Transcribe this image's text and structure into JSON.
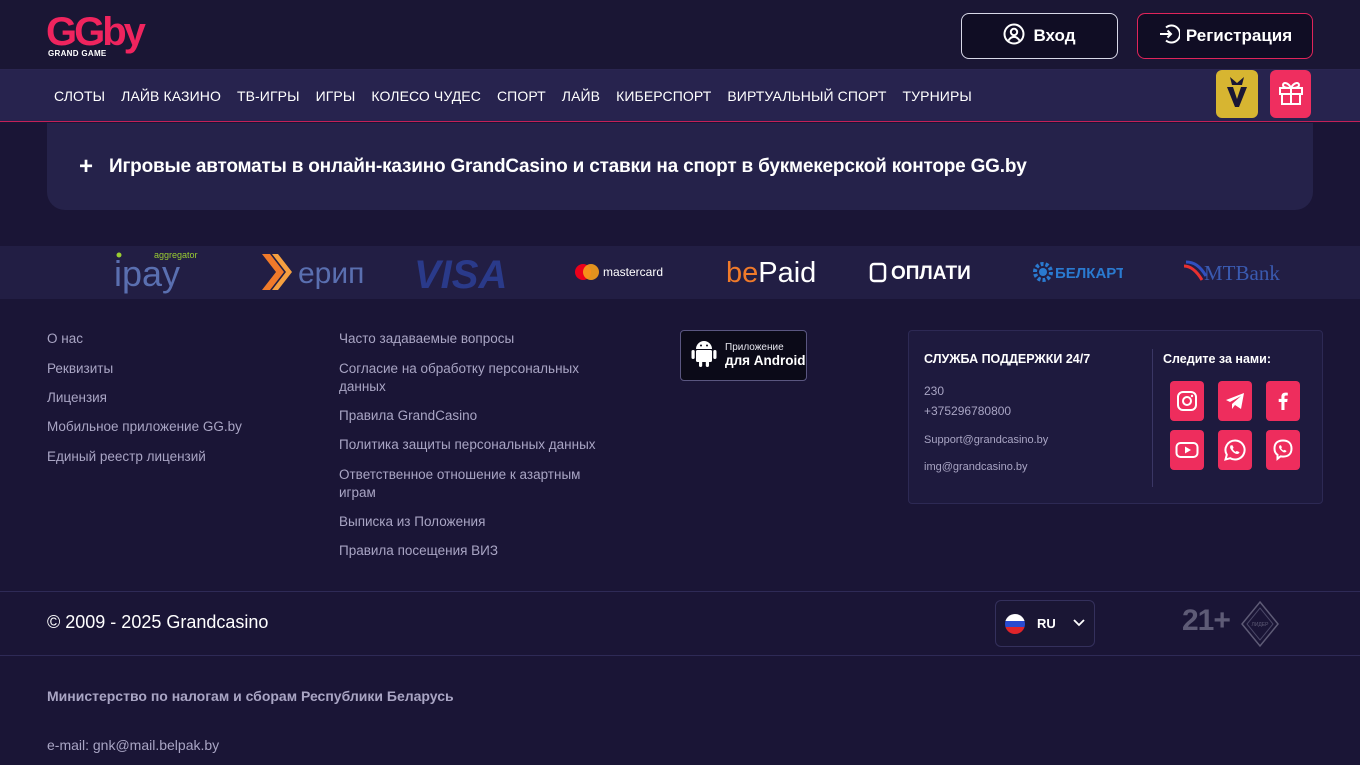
{
  "header": {
    "logo_text": "GGby",
    "logo_sub": "GRAND GAME",
    "login_label": "Вход",
    "register_label": "Регистрация"
  },
  "nav": {
    "items": [
      "СЛОТЫ",
      "ЛАЙВ КАЗИНО",
      "ТВ-ИГРЫ",
      "ИГРЫ",
      "КОЛЕСО ЧУДЕС",
      "СПОРТ",
      "ЛАЙВ",
      "КИБЕРСПОРТ",
      "ВИРТУАЛЬНЫЙ СПОРТ",
      "ТУРНИРЫ"
    ]
  },
  "accordion": {
    "icon": "+",
    "title": "Игровые автоматы в онлайн-казино GrandCasino и ставки на спорт в букмекерской конторе GG.by"
  },
  "payments": {
    "ipay": "ipay",
    "ipay_tag": "aggregator",
    "erip": "ерип",
    "visa": "VISA",
    "mastercard": "mastercard",
    "bepaid_be": "be",
    "bepaid_paid": "Paid",
    "oplati": "ОПЛАТИ",
    "belkart": "БЕЛКАРТ",
    "mtbank": "MTBank"
  },
  "footer": {
    "col1": [
      "О нас",
      "Реквизиты",
      "Лицензия",
      "Мобильное приложение GG.by",
      "Единый реестр лицензий"
    ],
    "col2": [
      "Часто задаваемые вопросы",
      "Согласие на обработку персональных данных",
      "Правила GrandCasino",
      "Политика защиты персональных данных",
      "Ответственное отношение к азартным играм",
      "Выписка из Положения",
      "Правила посещения ВИЗ"
    ],
    "android": {
      "line1": "Приложение",
      "line2": "для Android"
    },
    "support": {
      "title": "СЛУЖБА ПОДДЕРЖКИ 24/7",
      "phone_short": "230",
      "phone": "+375296780800",
      "email1": "Support@grandcasino.by",
      "email2": "img@grandcasino.by",
      "follow": "Следите за нами:"
    },
    "social_icons": [
      "instagram-icon",
      "telegram-icon",
      "facebook-icon",
      "youtube-icon",
      "whatsapp-icon",
      "viber-icon"
    ]
  },
  "bottom": {
    "copyright": "© 2009 - 2025 Grandcasino",
    "language": "RU",
    "age": "21+",
    "badge_text": "ЛИДЕР",
    "ministry": "Министерство по налогам и сборам Республики Беларусь",
    "email": "e-mail: gnk@mail.belpak.by"
  },
  "colors": {
    "accent": "#f0245e",
    "background": "#1a1536",
    "nav_bg": "#27234e",
    "vip": "#d7b531"
  }
}
